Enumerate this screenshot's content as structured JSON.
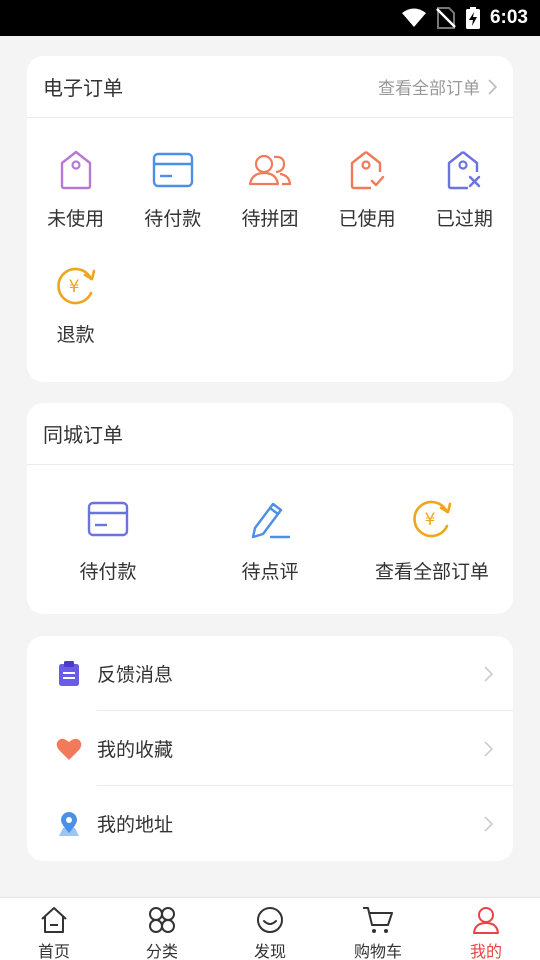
{
  "status_bar": {
    "time": "6:03"
  },
  "electronic_orders": {
    "title": "电子订单",
    "view_all": "查看全部订单",
    "items": [
      {
        "label": "未使用",
        "icon": "unused-tag-icon",
        "color": "#b57ad6"
      },
      {
        "label": "待付款",
        "icon": "card-icon",
        "color": "#4a8fe8"
      },
      {
        "label": "待拼团",
        "icon": "group-icon",
        "color": "#f07a5a"
      },
      {
        "label": "已使用",
        "icon": "used-tag-icon",
        "color": "#f07a5a"
      },
      {
        "label": "已过期",
        "icon": "expired-tag-icon",
        "color": "#6a73e0"
      },
      {
        "label": "退款",
        "icon": "refund-icon",
        "color": "#f0a51e"
      }
    ]
  },
  "city_orders": {
    "title": "同城订单",
    "items": [
      {
        "label": "待付款",
        "icon": "card-icon",
        "color": "#6a73e0"
      },
      {
        "label": "待点评",
        "icon": "pen-icon",
        "color": "#4a8fe8"
      },
      {
        "label": "查看全部订单",
        "icon": "yen-refresh-icon",
        "color": "#f0a51e"
      }
    ]
  },
  "menu": {
    "items": [
      {
        "label": "反馈消息",
        "icon": "clipboard-icon",
        "color": "#6a5ce6"
      },
      {
        "label": "我的收藏",
        "icon": "heart-icon",
        "color": "#f07a5a"
      },
      {
        "label": "我的地址",
        "icon": "location-pin-icon",
        "color": "#4a8fe8"
      }
    ]
  },
  "tabbar": {
    "items": [
      {
        "label": "首页",
        "icon": "home-icon"
      },
      {
        "label": "分类",
        "icon": "category-icon"
      },
      {
        "label": "发现",
        "icon": "discover-icon"
      },
      {
        "label": "购物车",
        "icon": "cart-icon"
      },
      {
        "label": "我的",
        "icon": "user-icon",
        "active": true
      }
    ],
    "active_color": "#e64545"
  }
}
